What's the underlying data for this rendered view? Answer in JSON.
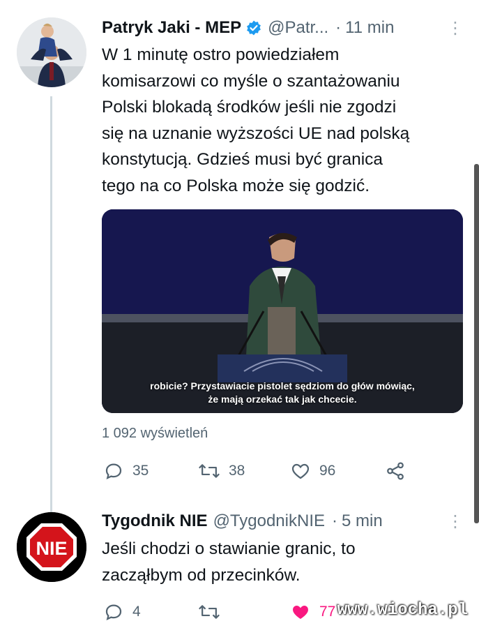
{
  "tweet1": {
    "author": "Patryk Jaki - MEP",
    "handle": "@Patr...",
    "separator": "·",
    "time": "11 min",
    "more": "⋮",
    "text_lines": [
      "W 1 minutę ostro powiedziałem",
      "komisarzowi co myśle o szantażowaniu",
      "Polski blokadą środków jeśli nie zgodzi",
      "się na uznanie wyższości UE nad polską",
      "konstytucją. Gdzieś musi być granica",
      "tego na co Polska może się godzić."
    ],
    "video_subtitle_lines": [
      "robicie? Przystawiacie pistolet sędziom do głów mówiąc,",
      "że mają orzekać tak jak chcecie."
    ],
    "views": "1 092 wyświetleń",
    "replies": "35",
    "retweets": "38",
    "likes": "96"
  },
  "tweet2": {
    "author": "Tygodnik NIE",
    "handle": "@TygodnikNIE",
    "separator": "·",
    "time": "5 min",
    "more": "⋮",
    "avatar_text": "NIE",
    "text_lines": [
      "Jeśli chodzi o stawianie granic, to",
      "zacząłbym od przecinków."
    ],
    "replies": "4",
    "likes": "77"
  },
  "watermark": "www.wiocha.pl",
  "colors": {
    "verified": "#1d9bf0",
    "secondary_text": "#536471",
    "like_active": "#f91880",
    "thread_line": "#cfd9de"
  },
  "icons": [
    "reply-icon",
    "retweet-icon",
    "like-icon",
    "share-icon",
    "verified-icon",
    "more-icon"
  ]
}
